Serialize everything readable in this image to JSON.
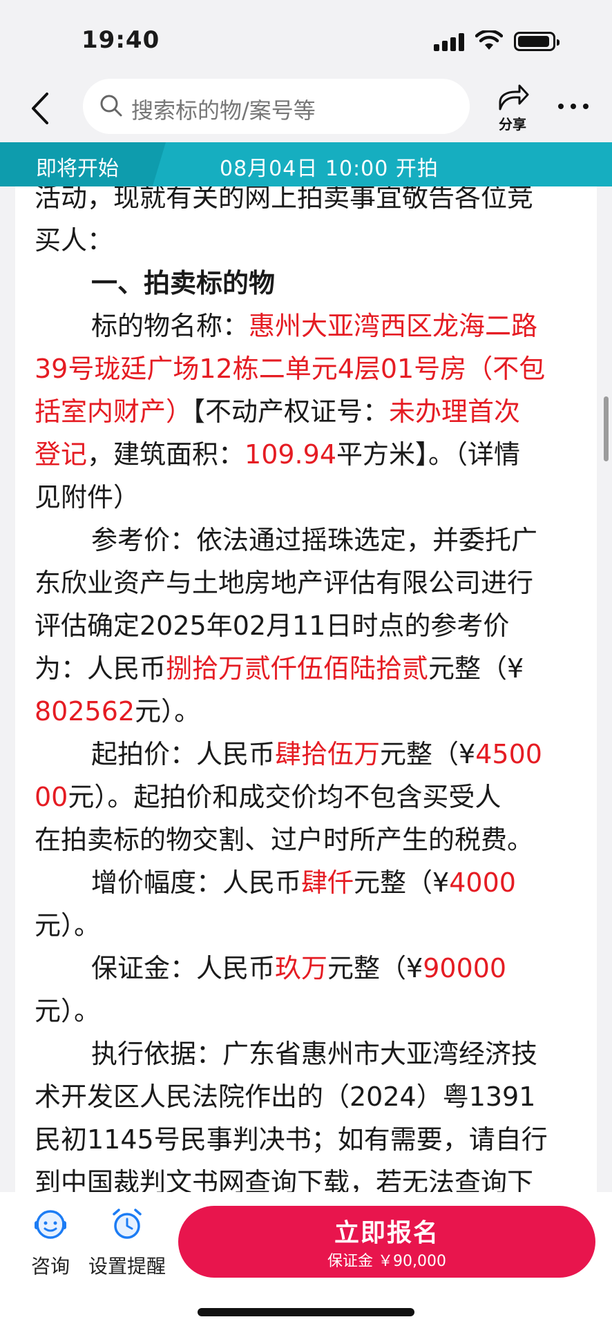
{
  "status_bar": {
    "time": "19:40"
  },
  "nav": {
    "search_placeholder": "搜索标的物/案号等",
    "share_label": "分享"
  },
  "auction_bar": {
    "state": "即将开始",
    "start_time": "08月04日 10:00 开拍"
  },
  "content": {
    "l1": "活动，现就有关的网上拍卖事宜敬告各位竞",
    "l2": "买人：",
    "section_title": "一、拍卖标的物",
    "name_label": "标的物名称：",
    "name_value_1": "惠州大亚湾西区龙海二路",
    "name_value_2": "39号珑廷广场12栋二单元4层01号房（不包",
    "name_value_3": "括室内财产）",
    "cert_label": "【不动产权证号：",
    "cert_value_1": "未办理首次",
    "cert_value_2": "登记",
    "area_label": "，建筑面积：",
    "area_value": "109.94",
    "area_unit": "平方米】。（详情",
    "see_attachment": "见附件）",
    "ref_l1": "参考价：依法通过摇珠选定，并委托广",
    "ref_l2": "东欣业资产与土地房地产评估有限公司进行",
    "ref_l3": "评估确定2025年02月11日时点的参考价",
    "ref_l4_pre": "为：人民币",
    "ref_l4_red": "捌拾万贰仟伍佰陆拾贰",
    "ref_l4_post": "元整（¥",
    "ref_l5_red": "802562",
    "ref_l5_post": "元）。",
    "start_l1_pre": "起拍价：人民币",
    "start_l1_red": "肆拾伍万",
    "start_l1_mid": "元整（¥",
    "start_l1_red2": "4500",
    "start_l2_red": "00",
    "start_l2_post": "元）。起拍价和成交价均不包含买受人",
    "start_l3": "在拍卖标的物交割、过户时所产生的税费。",
    "inc_pre": "增价幅度：人民币",
    "inc_red": "肆仟",
    "inc_mid": "元整（¥",
    "inc_red2": "4000",
    "inc_l2": "元）。",
    "dep_pre": "保证金：人民币",
    "dep_red": "玖万",
    "dep_mid": "元整（¥",
    "dep_red2": "90000",
    "dep_l2": "元）。",
    "basis_l1": "执行依据：广东省惠州市大亚湾经济技",
    "basis_l2": "术开发区人民法院作出的（2024）粤1391",
    "basis_l3": "民初1145号民事判决书；如有需要，请自行",
    "basis_l4": "到中国裁判文书网查询下载，若无法查询下"
  },
  "bottom": {
    "consult_label": "咨询",
    "remind_label": "设置提醒",
    "signup_label": "立即报名",
    "deposit_text": "保证金 ￥90,000"
  },
  "colors": {
    "accent_red": "#e51c23",
    "signup_button": "#e8154d",
    "auction_bar": "#16aec0"
  },
  "icons": [
    "back-arrow-icon",
    "search-icon",
    "share-icon",
    "more-icon",
    "consult-icon",
    "alarm-clock-icon"
  ]
}
